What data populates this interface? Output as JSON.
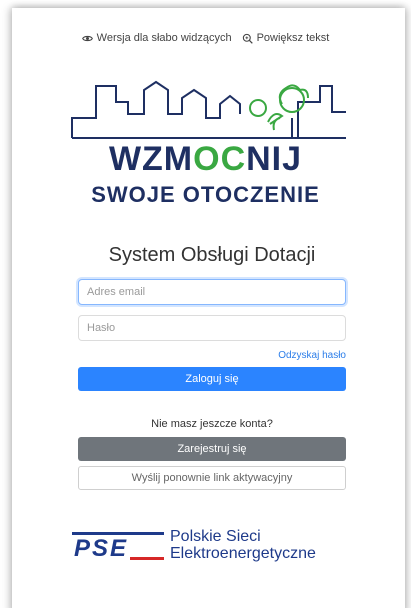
{
  "a11y": {
    "low_vision": "Wersja dla słabo widzących",
    "zoom": "Powiększ tekst"
  },
  "brand": {
    "line1_a": "WZM",
    "line1_b": "OC",
    "line1_c": "NIJ",
    "line2": "SWOJE OTOCZENIE",
    "colors": {
      "navy": "#1e2f62",
      "green": "#3aa842"
    }
  },
  "title": "System Obsługi Dotacji",
  "form": {
    "email_placeholder": "Adres email",
    "password_placeholder": "Hasło",
    "recover": "Odzyskaj hasło",
    "login": "Zaloguj się"
  },
  "register": {
    "prompt": "Nie masz jeszcze konta?",
    "register_button": "Zarejestruj się",
    "resend_button": "Wyślij ponownie link aktywacyjny"
  },
  "footer": {
    "logo_letters": "PSE",
    "org_line1": "Polskie Sieci",
    "org_line2": "Elektroenergetyczne"
  },
  "icons": {
    "low_vision": "eye-icon",
    "zoom": "magnifier-icon"
  }
}
